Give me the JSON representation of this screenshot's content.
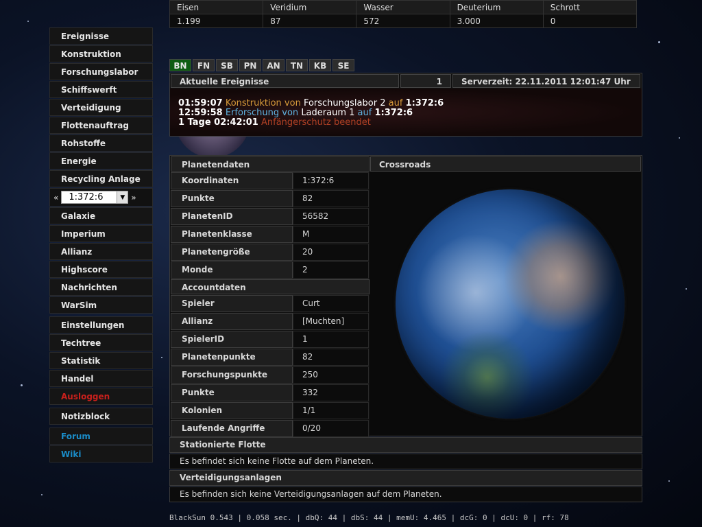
{
  "resources": {
    "headers": [
      "Eisen",
      "Veridium",
      "Wasser",
      "Deuterium",
      "Schrott"
    ],
    "values": [
      "1.199",
      "87",
      "572",
      "3.000",
      "0"
    ]
  },
  "menu": {
    "items": [
      {
        "label": "Ereignisse"
      },
      {
        "label": "Konstruktion"
      },
      {
        "label": "Forschungslabor"
      },
      {
        "label": "Schiffswerft"
      },
      {
        "label": "Verteidigung"
      },
      {
        "label": "Flottenauftrag"
      },
      {
        "label": "Rohstoffe"
      },
      {
        "label": "Energie"
      },
      {
        "label": "Recycling Anlage"
      }
    ],
    "coord_select": {
      "prev": "«",
      "value": "1:372:6",
      "next": "»"
    },
    "items2": [
      {
        "label": "Galaxie"
      },
      {
        "label": "Imperium"
      },
      {
        "label": "Allianz"
      },
      {
        "label": "Highscore"
      },
      {
        "label": "Nachrichten"
      },
      {
        "label": "WarSim"
      }
    ],
    "items3": [
      {
        "label": "Einstellungen"
      },
      {
        "label": "Techtree"
      },
      {
        "label": "Statistik"
      },
      {
        "label": "Handel"
      },
      {
        "label": "Ausloggen"
      }
    ],
    "items4": [
      {
        "label": "Notizblock"
      }
    ],
    "items5": [
      {
        "label": "Forum"
      },
      {
        "label": "Wiki"
      }
    ]
  },
  "tabs": [
    "BN",
    "FN",
    "SB",
    "PN",
    "AN",
    "TN",
    "KB",
    "SE"
  ],
  "events": {
    "title": "Aktuelle Ereignisse",
    "count": "1",
    "server_time": "Serverzeit: 22.11.2011 12:01:47 Uhr",
    "lines": [
      {
        "time": "01:59:07",
        "action": "Konstruktion",
        "von": "von",
        "object": "Forschungslabor 2",
        "auf": "auf",
        "target": "1:372:6"
      },
      {
        "time": "12:59:58",
        "action": "Erforschung",
        "von": "von",
        "object": "Laderaum 1",
        "auf": "auf",
        "target": "1:372:6"
      },
      {
        "time": "1 Tage 02:42:01",
        "action": "Anfängerschutz beendet"
      }
    ]
  },
  "planet": {
    "header": "Planetendaten",
    "rows": [
      {
        "k": "Koordinaten",
        "v": "1:372:6"
      },
      {
        "k": "Punkte",
        "v": "82"
      },
      {
        "k": "PlanetenID",
        "v": "56582"
      },
      {
        "k": "Planetenklasse",
        "v": "M"
      },
      {
        "k": "Planetengröße",
        "v": "20"
      },
      {
        "k": "Monde",
        "v": "2"
      }
    ],
    "account_header": "Accountdaten",
    "account_rows": [
      {
        "k": "Spieler",
        "v": "Curt"
      },
      {
        "k": "Allianz",
        "v": "[Muchten]"
      },
      {
        "k": "SpielerID",
        "v": "1"
      },
      {
        "k": "Planetenpunkte",
        "v": "82"
      },
      {
        "k": "Forschungspunkte",
        "v": "250"
      },
      {
        "k": "Punkte",
        "v": "332"
      },
      {
        "k": "Kolonien",
        "v": "1/1"
      },
      {
        "k": "Laufende Angriffe",
        "v": "0/20"
      }
    ],
    "name": "Crossroads"
  },
  "fleet": {
    "header": "Stationierte Flotte",
    "message": "Es befindet sich keine Flotte auf dem Planeten."
  },
  "defense": {
    "header": "Verteidigungsanlagen",
    "message": "Es befinden sich keine Verteidigungsanlagen auf dem Planeten."
  },
  "footer": "BlackSun 0.543 | 0.058 sec. | dbQ: 44 | dbS: 44 | memU: 4.465 | dcG: 0 | dcU: 0 | rf: 78",
  "colors": {
    "active_tab": "#0d5c11",
    "logout": "#c8201c",
    "link_blue": "#1a8cc8",
    "event_orange": "#d69a3a",
    "event_blue": "#5fb2e0",
    "event_red": "#b04024"
  }
}
